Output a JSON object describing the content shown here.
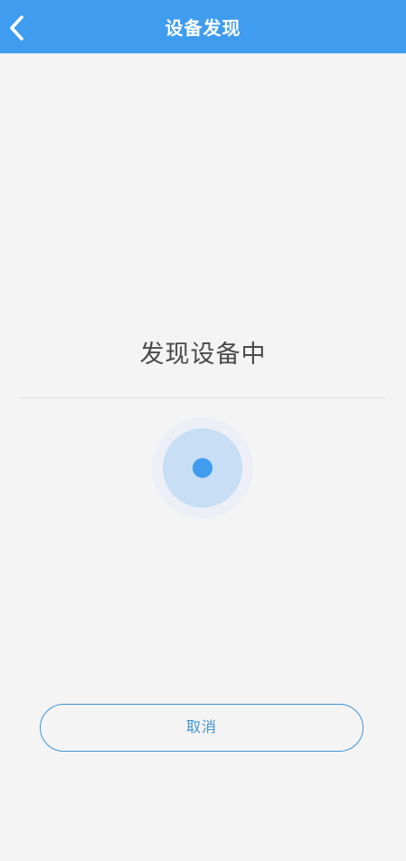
{
  "header": {
    "title": "设备发现",
    "back_icon": "chevron-left-icon"
  },
  "main": {
    "status_text": "发现设备中"
  },
  "actions": {
    "cancel_label": "取消"
  },
  "colors": {
    "header_bg": "#3f9cee",
    "accent": "#3f9cee",
    "background": "#f4f4f4",
    "button_border": "#3f93d6"
  }
}
